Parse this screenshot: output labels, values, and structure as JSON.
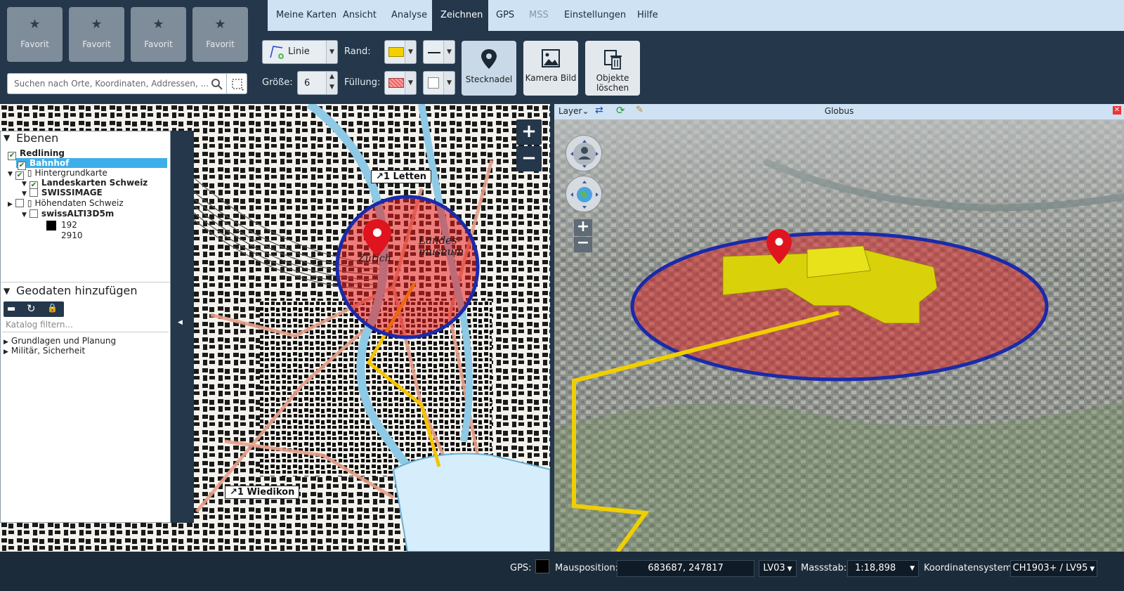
{
  "favorites": [
    {
      "label": "Favorit"
    },
    {
      "label": "Favorit"
    },
    {
      "label": "Favorit"
    },
    {
      "label": "Favorit"
    }
  ],
  "search": {
    "placeholder": "Suchen nach Orte, Koordinaten, Addressen, ..."
  },
  "tabs": [
    {
      "label": "Meine Karten"
    },
    {
      "label": "Ansicht"
    },
    {
      "label": "Analyse"
    },
    {
      "label": "Zeichnen"
    },
    {
      "label": "GPS"
    },
    {
      "label": "MSS"
    },
    {
      "label": "Einstellungen"
    },
    {
      "label": "Hilfe"
    }
  ],
  "toolbar": {
    "line_type": "Linie",
    "size_label": "Größe:",
    "size_value": "6",
    "border_label": "Rand:",
    "fill_label": "Füllung:",
    "border_color": "#f5d000",
    "fill_color": "#f06060",
    "pin_label": "Stecknadel",
    "camera_label": "Kamera Bild",
    "delete_label": "Objekte löschen"
  },
  "layers": {
    "title": "Ebenen",
    "items": [
      {
        "label": "Redlining"
      },
      {
        "label": "Bahnhof"
      },
      {
        "label": "Hintergrundkarte"
      },
      {
        "label": "Landeskarten Schweiz"
      },
      {
        "label": "SWISSIMAGE"
      },
      {
        "label": "Höhendaten Schweiz"
      },
      {
        "label": "swissALTI3D5m"
      }
    ],
    "legend_min": "192",
    "legend_max": "2910"
  },
  "geodata": {
    "title": "Geodaten hinzufügen",
    "filter_placeholder": "Katalog filtern...",
    "items": [
      {
        "label": "Grundlagen und Planung"
      },
      {
        "label": "Militär, Sicherheit"
      }
    ]
  },
  "map_labels": {
    "letten": "↗1 Letten",
    "wiedikon": "↗1 Wiedikon",
    "museum": "Landes- museum",
    "zurich": "Zürich"
  },
  "globe": {
    "layer_label": "Layer",
    "title": "Globus"
  },
  "status": {
    "gps_label": "GPS:",
    "mouse_label": "Mausposition:",
    "mouse_value": "683687, 247817",
    "crs_short": "LV03",
    "scale_label": "Massstab:",
    "scale_value": "1:18,898",
    "crs_label": "Koordinatensystem:",
    "crs_value": "CH1903+ / LV95"
  }
}
